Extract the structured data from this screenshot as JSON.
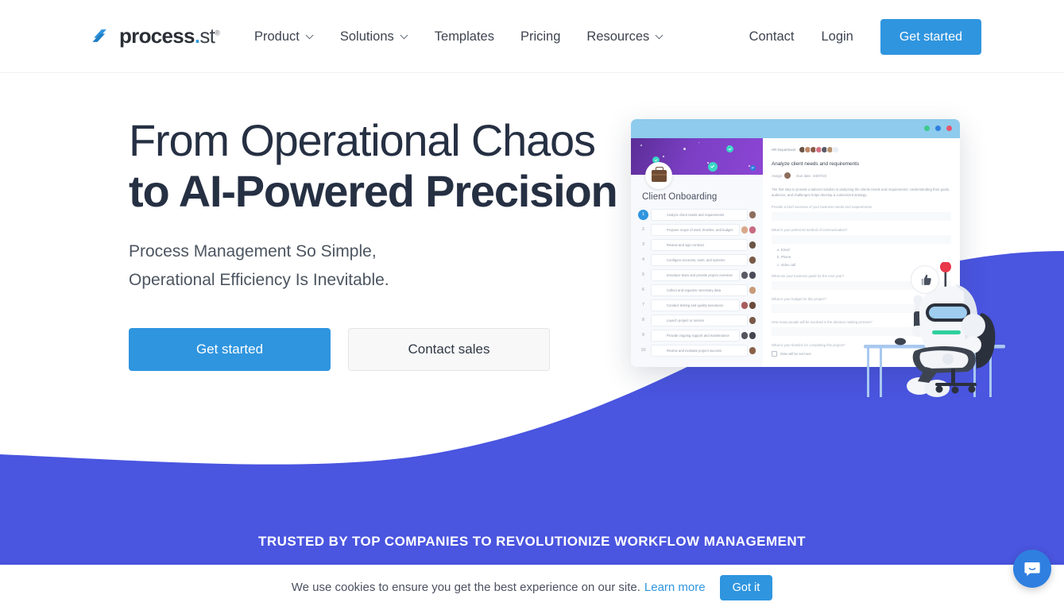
{
  "brand": {
    "logo_text": "process",
    "logo_dot": ".",
    "logo_suffix": "st",
    "registered": "®",
    "accent_blue": "#2f95df",
    "accent_purple": "#4a55e0",
    "text_dark": "#263043"
  },
  "nav": {
    "items": [
      {
        "label": "Product",
        "has_caret": true
      },
      {
        "label": "Solutions",
        "has_caret": true
      },
      {
        "label": "Templates",
        "has_caret": false
      },
      {
        "label": "Pricing",
        "has_caret": false
      },
      {
        "label": "Resources",
        "has_caret": true
      }
    ],
    "contact": "Contact",
    "login": "Login",
    "get_started": "Get started"
  },
  "hero": {
    "headline_line1": "From Operational Chaos",
    "headline_line2": "to AI-Powered Precision",
    "sub_line1": "Process Management So Simple,",
    "sub_line2": "Operational Efficiency Is Inevitable.",
    "cta_primary": "Get started",
    "cta_secondary": "Contact sales"
  },
  "mockup": {
    "window_dots": [
      "#3ec98a",
      "#2f7fe0",
      "#e8556d"
    ],
    "workflow_title": "Client Onboarding",
    "tasks": [
      {
        "num": "1",
        "label": "Analyze client needs and requirements",
        "avatars": [
          "#8d6e5c"
        ]
      },
      {
        "num": "2",
        "label": "Propose scope of work, timeline, and budget",
        "avatars": [
          "#d9a88a",
          "#c86a82"
        ]
      },
      {
        "num": "3",
        "label": "Review and sign contract",
        "avatars": [
          "#6b5445"
        ]
      },
      {
        "num": "4",
        "label": "Configure accounts, tools, and systems",
        "avatars": [
          "#7a5a48"
        ]
      },
      {
        "num": "5",
        "label": "Introduce team and provide project overview",
        "avatars": [
          "#5a5a66",
          "#4a4a58"
        ]
      },
      {
        "num": "6",
        "label": "Collect and organize necessary data",
        "avatars": [
          "#c89a7a"
        ]
      },
      {
        "num": "7",
        "label": "Conduct testing and quality assurance",
        "avatars": [
          "#a85c5c",
          "#6b4a3a"
        ]
      },
      {
        "num": "8",
        "label": "Launch project or service",
        "avatars": [
          "#7a5a48"
        ]
      },
      {
        "num": "9",
        "label": "Provide ongoing support and maintenance",
        "avatars": [
          "#555560",
          "#45454f"
        ]
      },
      {
        "num": "10",
        "label": "Review and evaluate project success",
        "avatars": [
          "#8a6048"
        ]
      }
    ],
    "detail": {
      "department": "HR Department",
      "task_title": "Analyze client needs and requirements",
      "assign_label": "Assign",
      "due_label": "Due date",
      "due_value": "04/07/23",
      "body_p1": "The first step to provide a tailored solution is analyzing the clients needs and requirements. Understanding their goals, audience, and challenges helps develop a customized strategy.",
      "body_p2": "Provide a brief overview of your business needs and requirements.",
      "q1": "What is your preferred method of communication?",
      "options": [
        "a. Email",
        "b. Phone",
        "c. Video call"
      ],
      "q2": "What are your business goals for the next year?",
      "q3": "What is your budget for this project?",
      "q4": "How many people will be involved in the decision making process?",
      "q5": "What is your timeline for completing this project?",
      "date_placeholder": "Date will be set here"
    }
  },
  "trusted_banner": "TRUSTED BY TOP COMPANIES TO REVOLUTIONIZE WORKFLOW MANAGEMENT",
  "cookie": {
    "message": "We use cookies to ensure you get the best experience on our site.",
    "link": "Learn more",
    "button": "Got it"
  },
  "icons": {
    "chevron": "chevron-down-icon",
    "chat": "chat-bubble-icon",
    "thumbs_up": "thumbs-up-icon"
  }
}
